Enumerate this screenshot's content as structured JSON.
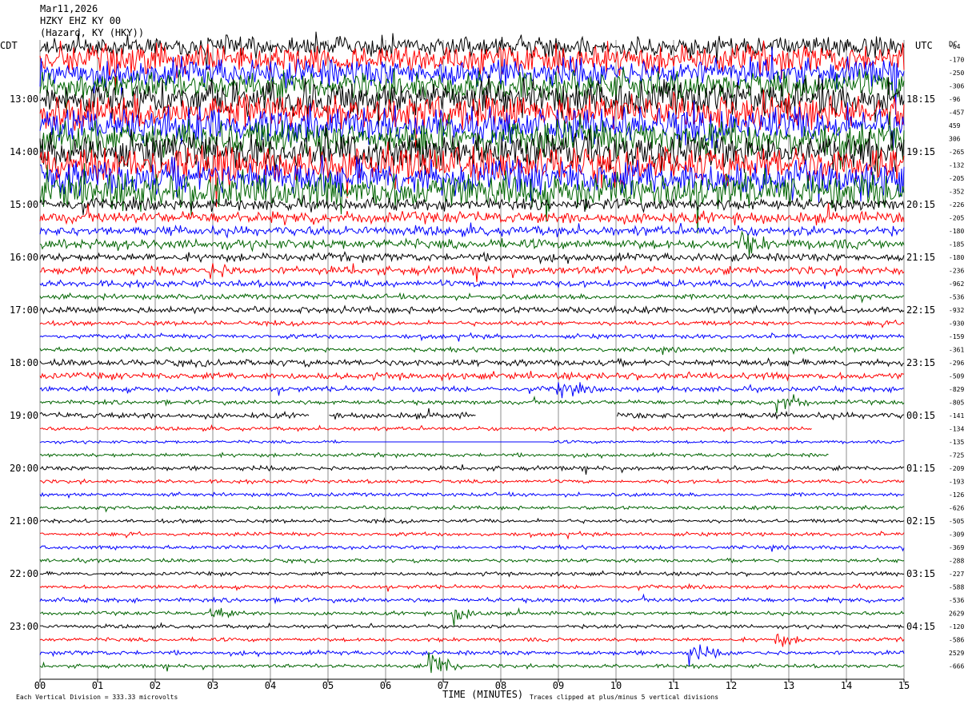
{
  "header": {
    "date": "Mar11,2026",
    "channel": "HZKY EHZ KY 00",
    "station": "(Hazard, KY (HKY))"
  },
  "left_timezone": "CDT",
  "right_timezone": "UTC",
  "dc_label": "DC",
  "x_axis_title": "TIME (MINUTES)",
  "footer_left": "Each Vertical Division =  333.33 microvolts",
  "footer_right": "Traces clipped at plus/minus 5 vertical divisions",
  "chart_data": {
    "type": "line",
    "x": [
      0,
      1,
      2,
      3,
      4,
      5,
      6,
      7,
      8,
      9,
      10,
      11,
      12,
      13,
      14,
      15
    ],
    "xtick_labels": [
      "00",
      "01",
      "02",
      "03",
      "04",
      "05",
      "06",
      "07",
      "08",
      "09",
      "10",
      "11",
      "12",
      "13",
      "14",
      "15"
    ],
    "xlim": [
      0,
      15
    ],
    "xlabel": "TIME (MINUTES)",
    "trace_colors": [
      "#000000",
      "#ff0000",
      "#0000ff",
      "#006400"
    ],
    "trace_interval_minutes": 15,
    "trace_count": 48,
    "left_hour_labels": [
      "13:00",
      "14:00",
      "15:00",
      "16:00",
      "17:00",
      "18:00",
      "19:00",
      "20:00",
      "21:00",
      "22:00",
      "23:00"
    ],
    "right_hour_labels": [
      "18:15",
      "19:15",
      "20:15",
      "21:15",
      "22:15",
      "23:15",
      "00:15",
      "01:15",
      "02:15",
      "03:15",
      "04:15"
    ],
    "hour_label_first_trace": 4,
    "dc_offsets": [
      "-64",
      "-170",
      "-250",
      "-306",
      "-96",
      "-457",
      "459",
      "306",
      "-265",
      "-132",
      "-205",
      "-352",
      "-226",
      "-205",
      "-180",
      "-185",
      "-180",
      "-236",
      "-962",
      "-536",
      "-932",
      "-930",
      "-159",
      "-361",
      "-296",
      "-509",
      "-829",
      "-805",
      "-141",
      "-134",
      "-135",
      "-725",
      "-209",
      "-193",
      "-126",
      "-626",
      "-505",
      "-309",
      "-369",
      "-288",
      "-227",
      "-588",
      "-536",
      "2629",
      "-120",
      "-586",
      "2529",
      "-666"
    ],
    "amplitude_levels": [
      3,
      4,
      4,
      4,
      5,
      5,
      5,
      5,
      5,
      5,
      5,
      5,
      1.6,
      1.6,
      1.3,
      1.3,
      1.1,
      1.1,
      0.9,
      0.7,
      0.9,
      0.6,
      0.6,
      0.6,
      0.9,
      0.9,
      0.7,
      0.6,
      0.8,
      0.5,
      0.4,
      0.5,
      0.6,
      0.5,
      0.5,
      0.5,
      0.5,
      0.5,
      0.5,
      0.5,
      0.5,
      0.5,
      0.6,
      0.5,
      0.5,
      0.5,
      0.6,
      0.5
    ],
    "gaps": [
      {
        "trace": 28,
        "from": 4.67,
        "to": 5.0
      },
      {
        "trace": 28,
        "from": 7.58,
        "to": 10.0
      },
      {
        "trace": 29,
        "from": 13.4,
        "to": 15.0
      },
      {
        "trace": 31,
        "from": 13.7,
        "to": 15.0
      }
    ],
    "flatlines": [
      {
        "trace": 30,
        "from": 5.35,
        "to": 8.83
      }
    ],
    "events": [
      {
        "trace": 17,
        "at": 3.0,
        "strength": 2
      },
      {
        "trace": 15,
        "at": 12.2,
        "strength": 3
      },
      {
        "trace": 26,
        "at": 9.0,
        "strength": 3
      },
      {
        "trace": 27,
        "at": 12.8,
        "strength": 4
      },
      {
        "trace": 43,
        "at": 3.0,
        "strength": 2
      },
      {
        "trace": 43,
        "at": 7.2,
        "strength": 3
      },
      {
        "trace": 46,
        "at": 11.3,
        "strength": 3
      },
      {
        "trace": 47,
        "at": 6.8,
        "strength": 5
      },
      {
        "trace": 45,
        "at": 12.8,
        "strength": 2
      }
    ]
  }
}
